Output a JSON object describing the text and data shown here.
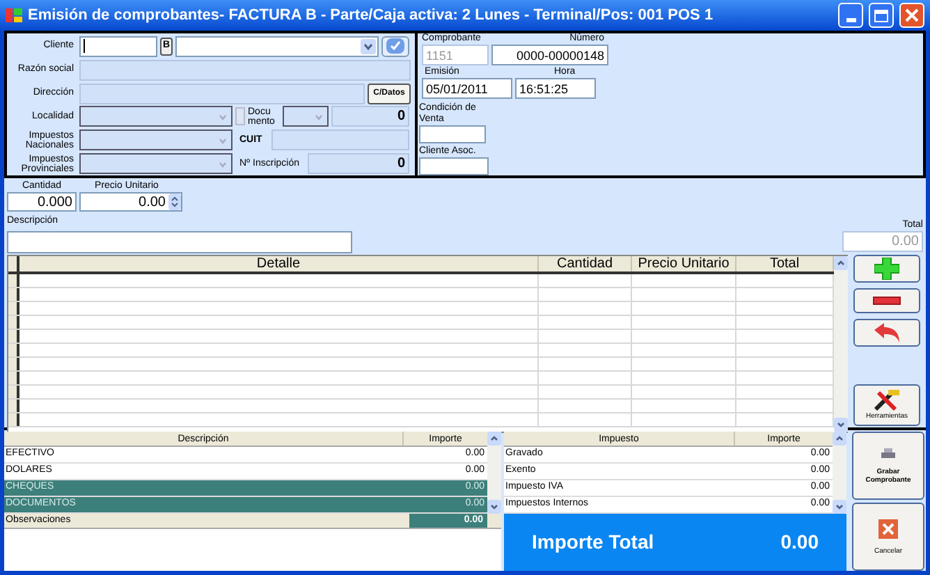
{
  "window": {
    "title": "Emisión de comprobantes- FACTURA B - Parte/Caja activa: 2 Lunes - Terminal/Pos: 001 POS 1"
  },
  "client_section": {
    "cliente_label": "Cliente",
    "type_letter": "B",
    "razon_social_label": "Razón social",
    "direccion_label": "Dirección",
    "datos_button": "C/Datos",
    "localidad_label": "Localidad",
    "documento_label": "Docu mento",
    "documento_value": "0",
    "impuestos_nacionales_label": "Impuestos Nacionales",
    "cuit_label": "CUIT",
    "impuestos_provinciales_label": "Impuestos Provinciales",
    "inscripcion_label": "Nº Inscripción",
    "inscripcion_value": "0"
  },
  "voucher": {
    "comprobante_label": "Comprobante",
    "comprobante_value": "1151",
    "numero_label": "Número",
    "numero_value": "0000-00000148",
    "emision_label": "Emisión",
    "emision_value": "05/01/2011",
    "hora_label": "Hora",
    "hora_value": "16:51:25",
    "condicion_label": "Condición de Venta",
    "cliente_asoc_label": "Cliente Asoc."
  },
  "entry": {
    "cantidad_label": "Cantidad",
    "cantidad_value": "0.000",
    "precio_label": "Precio Unitario",
    "precio_value": "0.00",
    "descripcion_label": "Descripción",
    "total_label": "Total",
    "total_value": "0.00"
  },
  "detail_table": {
    "columns": [
      "Detalle",
      "Cantidad",
      "Precio Unitario",
      "Total"
    ]
  },
  "side_buttons": {
    "tools_label": "Herramientas"
  },
  "payments": {
    "columns": [
      "Descripción",
      "Importe"
    ],
    "rows": [
      {
        "descripcion": "EFECTIVO",
        "importe": "0.00",
        "selected": false
      },
      {
        "descripcion": "DOLARES",
        "importe": "0.00",
        "selected": false
      },
      {
        "descripcion": "CHEQUES",
        "importe": "0.00",
        "selected": true
      },
      {
        "descripcion": "DOCUMENTOS",
        "importe": "0.00",
        "selected": true
      }
    ],
    "observaciones_label": "Observaciones",
    "observaciones_value": "0.00"
  },
  "taxes": {
    "columns": [
      "Impuesto",
      "Importe"
    ],
    "rows": [
      {
        "impuesto": "Gravado",
        "importe": "0.00"
      },
      {
        "impuesto": "Exento",
        "importe": "0.00"
      },
      {
        "impuesto": "Impuesto IVA",
        "importe": "0.00"
      },
      {
        "impuesto": "Impuestos Internos",
        "importe": "0.00"
      }
    ]
  },
  "total": {
    "label": "Importe Total",
    "value": "0.00"
  },
  "buttons": {
    "save": "Grabar Comprobante",
    "cancel": "Cancelar"
  }
}
